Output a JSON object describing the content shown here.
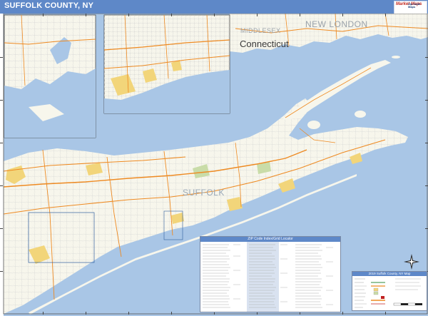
{
  "map": {
    "title": "SUFFOLK COUNTY, NY",
    "logo_text": "Market Maps",
    "logo_subtext": "Zip Code Maps",
    "labels": {
      "state": "Connecticut",
      "county_ct": "NEW LONDON",
      "county_ct2": "MIDDLESEX",
      "county_main": "SUFFOLK"
    },
    "zip_index_title": "ZIP Code Index/Grid Locator",
    "legend_title": "2019 Suffolk County, NY Map",
    "colors": {
      "water": "#a9c6e6",
      "land": "#f7f6ec",
      "urban": "#f2d57a",
      "park": "#c9dca8",
      "highway": "#ee8a22",
      "header": "#5e88c8"
    }
  }
}
